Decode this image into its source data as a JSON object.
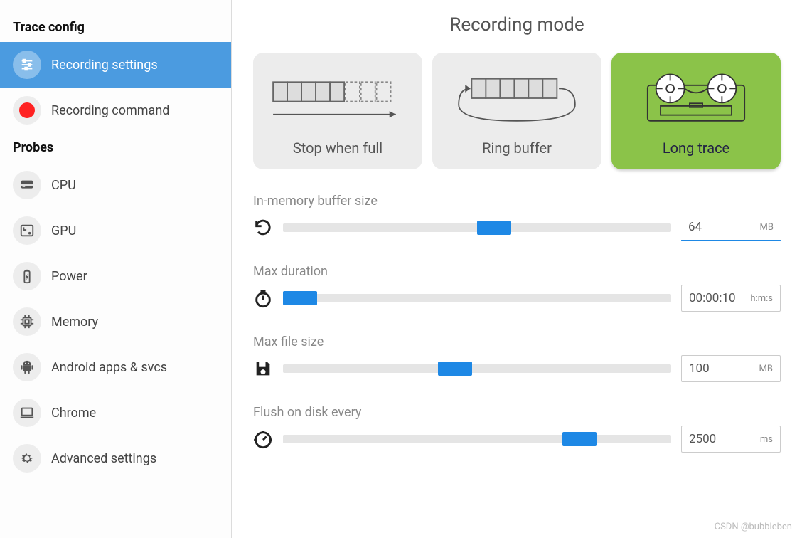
{
  "sidebar": {
    "section1_title": "Trace config",
    "items_config": [
      {
        "label": "Recording settings",
        "icon": "sliders",
        "active": true
      },
      {
        "label": "Recording command",
        "icon": "record",
        "active": false
      }
    ],
    "section2_title": "Probes",
    "items_probes": [
      {
        "label": "CPU",
        "icon": "cpu"
      },
      {
        "label": "GPU",
        "icon": "gpu"
      },
      {
        "label": "Power",
        "icon": "battery"
      },
      {
        "label": "Memory",
        "icon": "memory"
      },
      {
        "label": "Android apps & svcs",
        "icon": "android"
      },
      {
        "label": "Chrome",
        "icon": "laptop"
      },
      {
        "label": "Advanced settings",
        "icon": "gear"
      }
    ]
  },
  "main": {
    "heading": "Recording mode",
    "modes": [
      {
        "label": "Stop when full",
        "active": false
      },
      {
        "label": "Ring buffer",
        "active": false
      },
      {
        "label": "Long trace",
        "active": true
      }
    ],
    "sliders": [
      {
        "label": "In-memory buffer size",
        "icon": "refresh",
        "value": "64",
        "unit": "MB",
        "thumb_pct": 50,
        "value_active": true
      },
      {
        "label": "Max duration",
        "icon": "stopwatch",
        "value": "00:00:10",
        "unit": "h:m:s",
        "thumb_pct": 1,
        "value_active": false
      },
      {
        "label": "Max file size",
        "icon": "save",
        "value": "100",
        "unit": "MB",
        "thumb_pct": 40,
        "value_active": false
      },
      {
        "label": "Flush on disk every",
        "icon": "timer",
        "value": "2500",
        "unit": "ms",
        "thumb_pct": 72,
        "value_active": false
      }
    ]
  },
  "watermark": "CSDN @bubbleben"
}
